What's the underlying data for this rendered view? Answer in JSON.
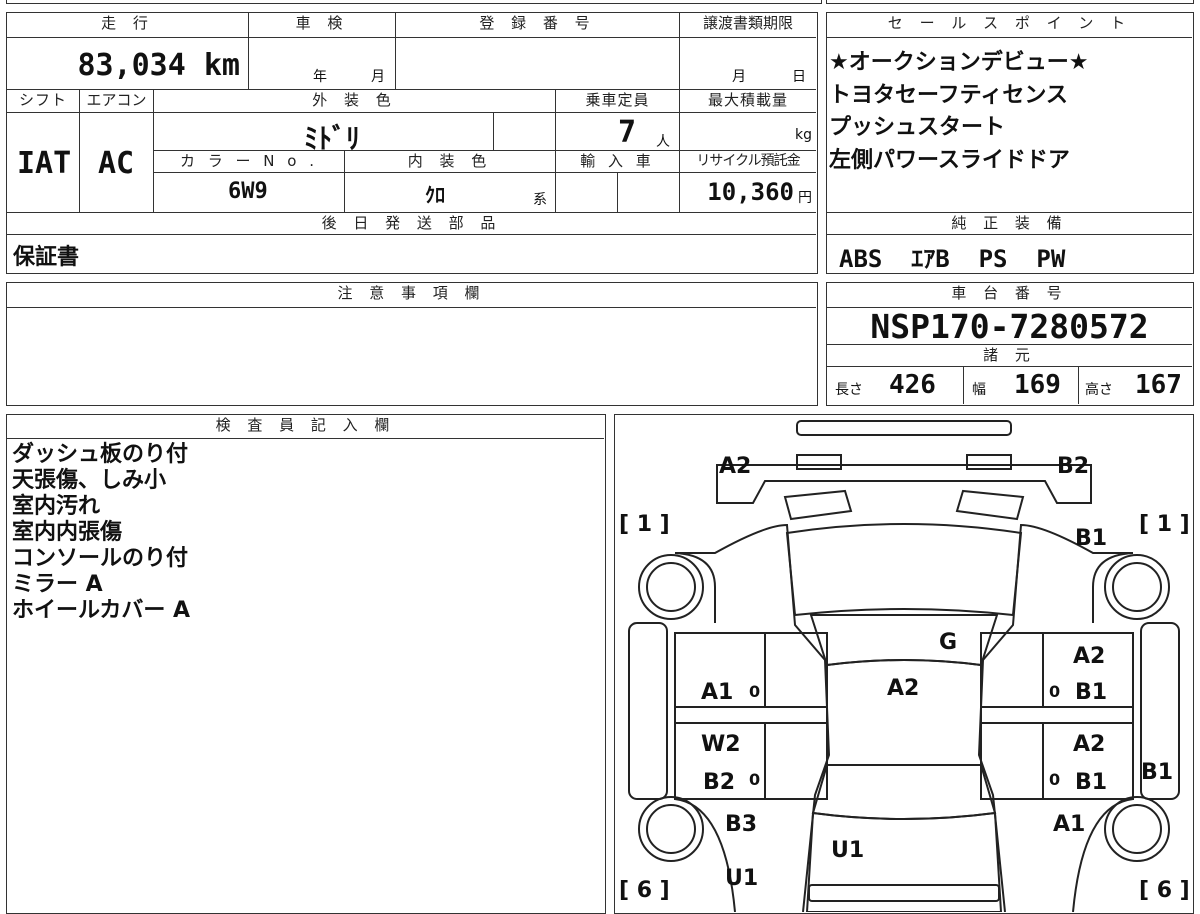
{
  "sheet": {
    "labels": {
      "mileage": "走 行",
      "inspection": "車 検",
      "registration": "登 録 番 号",
      "transfer_deadline": "譲渡書類期限",
      "shift": "シフト",
      "aircon": "エアコン",
      "exterior_color": "外 装 色",
      "capacity": "乗車定員",
      "max_load": "最大積載量",
      "color_no": "カ ラ ー N o .",
      "interior_color": "内 装 色",
      "import": "輸 入 車",
      "recycle_fee": "リサイクル預託金",
      "later_parts": "後 日 発 送 部 品",
      "notes": "注 意 事 項 欄",
      "inspector": "検 査 員 記 入 欄",
      "sales_points": "セ ー ル ス ポ イ ン ト",
      "genuine_equipment": "純 正 装 備",
      "chassis_no": "車 台 番 号",
      "specs": "諸 元",
      "year_unit": "年",
      "month_unit": "月",
      "day_unit": "日",
      "person_unit": "人",
      "kg_unit": "kg",
      "yen_unit": "円",
      "kei_unit": "系",
      "length": "長さ",
      "width": "幅",
      "height": "高さ"
    },
    "values": {
      "mileage": "83,034 km",
      "shift": "IAT",
      "aircon": "AC",
      "exterior_color": "ﾐﾄﾞﾘ",
      "capacity": "7",
      "color_no": "6W9",
      "interior_color": "ｸﾛ",
      "recycle_fee": "10,360",
      "later_parts": "保証書",
      "genuine_equipment": "ABS  ｴｱB  PS  PW",
      "chassis_no": "NSP170-7280572",
      "length": "426",
      "width": "169",
      "height": "167"
    },
    "sales_points": [
      "★オークションデビュー★",
      "トヨタセーフティセンス",
      "プッシュスタート",
      "左側パワースライドドア"
    ],
    "inspector_notes": [
      "ダッシュ板のり付",
      "天張傷、しみ小",
      "室内汚れ",
      "室内内張傷",
      "コンソールのり付",
      "ミラー A",
      "ホイールカバー A"
    ]
  },
  "diagram": {
    "marks": {
      "a2_top_left": "A2",
      "b2_top_right": "B2",
      "bracket_left_top": "[ 1 ]",
      "bracket_right_top": "[ 1 ]",
      "b1_right_upper": "B1",
      "g": "G",
      "a2_center": "A2",
      "a1_left": "A1",
      "zero_left_1": "0",
      "a2_right_1": "A2",
      "b1_right_1": "B1",
      "zero_right_1": "0",
      "w2_left": "W2",
      "b2_left": "B2",
      "zero_left_2": "0",
      "a2_right_2": "A2",
      "b1_right_2": "B1",
      "zero_right_2": "0",
      "b1_far_right": "B1",
      "b3_left": "B3",
      "a1_right": "A1",
      "u1_center": "U1",
      "u1_left": "U1",
      "bracket_left_bottom": "[ 6 ]",
      "bracket_right_bottom": "[ 6 ]"
    }
  }
}
